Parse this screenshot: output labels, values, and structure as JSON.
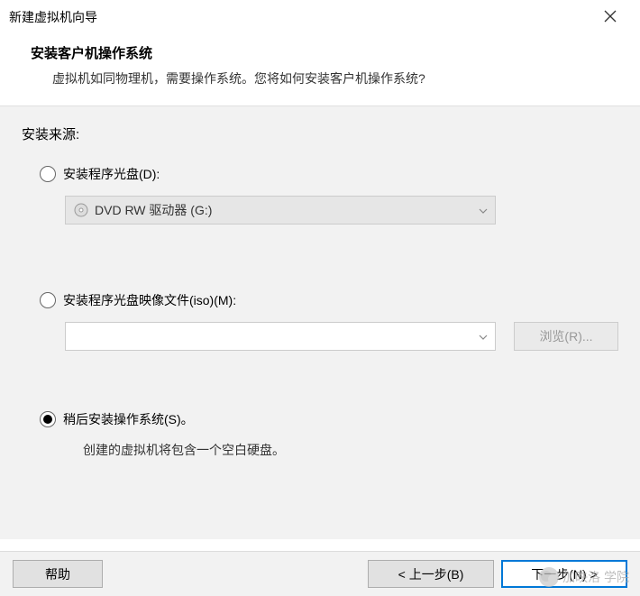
{
  "window": {
    "title": "新建虚拟机向导"
  },
  "header": {
    "title": "安装客户机操作系统",
    "subtitle": "虚拟机如同物理机，需要操作系统。您将如何安装客户机操作系统?"
  },
  "body": {
    "source_label": "安装来源:",
    "options": {
      "disc": {
        "label": "安装程序光盘(D):",
        "select_value": "DVD RW 驱动器 (G:)",
        "checked": false
      },
      "iso": {
        "label": "安装程序光盘映像文件(iso)(M):",
        "value": "",
        "browse_label": "浏览(R)...",
        "checked": false
      },
      "later": {
        "label": "稍后安装操作系统(S)。",
        "note": "创建的虚拟机将包含一个空白硬盘。",
        "checked": true
      }
    }
  },
  "footer": {
    "help": "帮助",
    "prev": "< 上一步(B)",
    "next": "下一步(N) >"
  },
  "watermark": {
    "text": "加昳洛 学院"
  }
}
